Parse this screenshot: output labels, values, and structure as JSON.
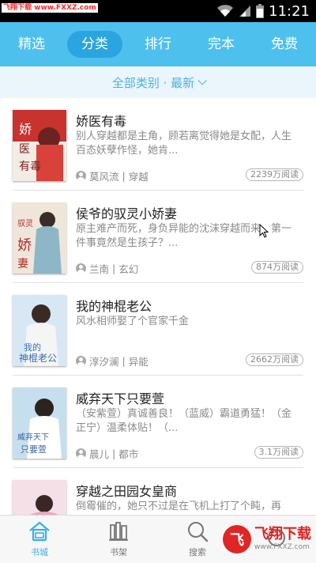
{
  "status_bar": {
    "watermark": "飞翔下载 www.FXXZ.com",
    "time": "11:21"
  },
  "top_tabs": [
    {
      "label": "精选",
      "active": false
    },
    {
      "label": "分类",
      "active": true
    },
    {
      "label": "排行",
      "active": false
    },
    {
      "label": "完本",
      "active": false
    },
    {
      "label": "免费",
      "active": false
    }
  ],
  "filter": {
    "label": "全部类别 · 最新"
  },
  "books": [
    {
      "title": "娇医有毒",
      "desc": "别人穿越都是主角，顾若离觉得她是女配，人生百态妖孽作怪，她肯...",
      "author": "莫风流",
      "genre": "穿越",
      "reads": "2239万阅读",
      "cover_color": "#c8322f"
    },
    {
      "title": "侯爷的驭灵小娇妻",
      "desc": "原主难产而死，身负异能的沈沫穿越而来，第一件事竟然是生孩子？...",
      "author": "兰南",
      "genre": "玄幻",
      "reads": "874万阅读",
      "cover_color": "#e9d9c7"
    },
    {
      "title": "我的神棍老公",
      "desc": "风水相师娶了个官家千金",
      "author": "淳汐澜",
      "genre": "异能",
      "reads": "2662万阅读",
      "cover_color": "#cfe3f2"
    },
    {
      "title": "威弃天下只要萱",
      "desc": "（安紫萱）真诚善良！（蓝威）霸道勇猛！（金正宁）温柔体贴！（...",
      "author": "晨儿",
      "genre": "都市",
      "reads": "3.1万阅读",
      "cover_color": "#b9d7ea"
    },
    {
      "title": "穿越之田园女皇商",
      "desc": "倒霉催的，她只不过是在飞机上打了个盹，再睁...",
      "author": "",
      "genre": "",
      "reads": "",
      "cover_color": "#f1d7de"
    }
  ],
  "bottom_nav": [
    {
      "label": "书城",
      "icon": "home-icon",
      "active": true
    },
    {
      "label": "书架",
      "icon": "bookshelf-icon",
      "active": false
    },
    {
      "label": "搜索",
      "icon": "search-icon",
      "active": false
    },
    {
      "label": "",
      "icon": "more-icon",
      "active": false
    }
  ],
  "watermark_br": {
    "main": "飞翔下载",
    "sub": "www.FXXZ.com"
  },
  "colors": {
    "accent": "#4dc0ee",
    "active_tab": "#2aa5df",
    "text_gray": "#8a8a8a"
  }
}
